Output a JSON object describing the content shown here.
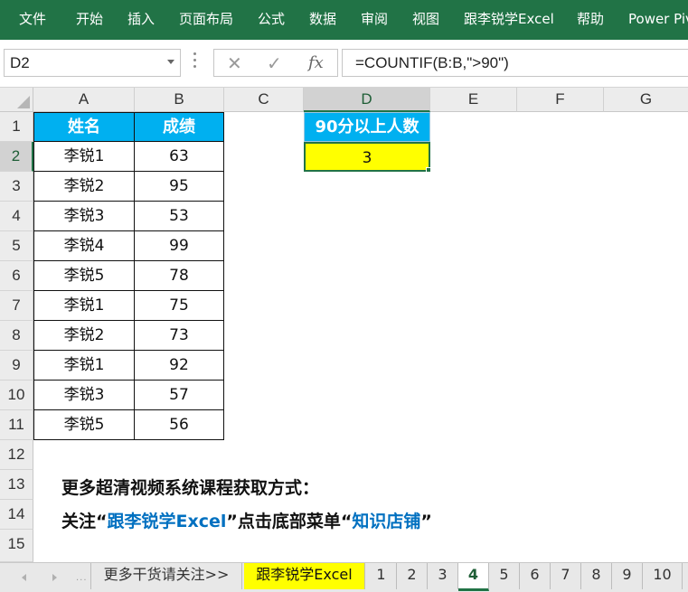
{
  "ribbon": {
    "tabs": [
      "文件",
      "开始",
      "插入",
      "页面布局",
      "公式",
      "数据",
      "审阅",
      "视图",
      "跟李锐学Excel",
      "帮助",
      "Power Pivot"
    ]
  },
  "formula_bar": {
    "name_box": "D2",
    "cancel_icon": "✕",
    "enter_icon": "✓",
    "function_icon": "fx",
    "formula": "=COUNTIF(B:B,\">90\")"
  },
  "columns": [
    "A",
    "B",
    "C",
    "D",
    "E",
    "F",
    "G"
  ],
  "rows": [
    "1",
    "2",
    "3",
    "4",
    "5",
    "6",
    "7",
    "8",
    "9",
    "10",
    "11",
    "12",
    "13",
    "14",
    "15"
  ],
  "table": {
    "headers": [
      "姓名",
      "成绩"
    ],
    "rows": [
      [
        "李锐1",
        "63"
      ],
      [
        "李锐2",
        "95"
      ],
      [
        "李锐3",
        "53"
      ],
      [
        "李锐4",
        "99"
      ],
      [
        "李锐5",
        "78"
      ],
      [
        "李锐1",
        "75"
      ],
      [
        "李锐2",
        "73"
      ],
      [
        "李锐1",
        "92"
      ],
      [
        "李锐3",
        "57"
      ],
      [
        "李锐5",
        "56"
      ]
    ]
  },
  "summary": {
    "header": "90分以上人数",
    "value": "3"
  },
  "notes": {
    "line1": "更多超清视频系统课程获取方式：",
    "line2_prefix": "关注“",
    "line2_brand": "跟李锐学Excel",
    "line2_mid": "”点击底部菜单“",
    "line2_shop": "知识店铺",
    "line2_suffix": "”"
  },
  "sheet_tabs": {
    "items": [
      "更多干货请关注>>",
      "跟李锐学Excel",
      "1",
      "2",
      "3",
      "4",
      "5",
      "6",
      "7",
      "8",
      "9",
      "10"
    ],
    "active": "4"
  },
  "colors": {
    "excel_green": "#217346",
    "header_blue": "#00b0f0",
    "highlight_yellow": "#ffff00",
    "note_blue": "#0070c0"
  }
}
